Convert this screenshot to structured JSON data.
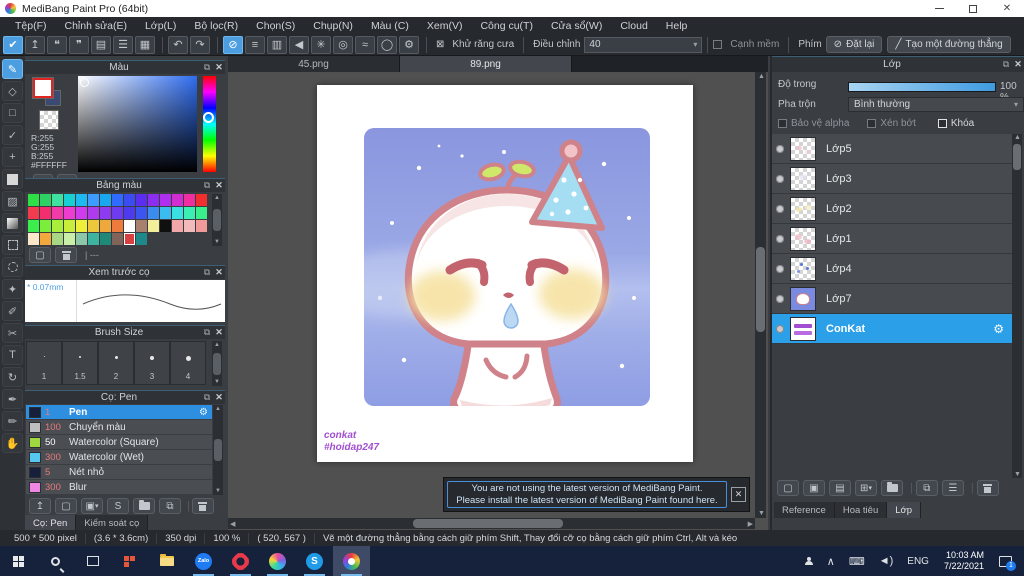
{
  "window": {
    "title": "MediBang Paint Pro (64bit)"
  },
  "menu": {
    "items": [
      "Tệp(F)",
      "Chỉnh sửa(E)",
      "Lớp(L)",
      "Bộ lọc(R)",
      "Chọn(S)",
      "Chụp(N)",
      "Màu (C)",
      "Xem(V)",
      "Công cụ(T)",
      "Cửa sổ(W)",
      "Cloud",
      "Help"
    ]
  },
  "icons": {
    "check": "✔",
    "share": "↥",
    "comment": "❝",
    "comment2": "❞",
    "doc": "▤",
    "doclist": "☰",
    "gridedit": "▦",
    "undo": "↶",
    "redo": "↷",
    "nosnap": "⊘",
    "parallel": "≡",
    "grid": "▥",
    "symmetry": "◀",
    "radial": "✳",
    "concentric": "◎",
    "curve": "≈",
    "ring": "◯",
    "gear": "⚙",
    "boxcheck": "⊠",
    "slash": "╱",
    "caret": "▾",
    "popout": "⧉",
    "close": "✕",
    "up": "▲",
    "down": "▼",
    "left": "◀",
    "right": "▶",
    "brush": "✎",
    "eraser": "◇",
    "rect": "□",
    "polyline": "✓",
    "move": "+",
    "wand": "✦",
    "selectpen": "✐",
    "selecteraser": "✂",
    "text": "T",
    "rotate": "↻",
    "pen2": "✒",
    "pencil": "✏",
    "hand": "✋",
    "new": "▢",
    "image": "▣",
    "sdoc": "S",
    "copy": "⧉",
    "addfolder": "⊞",
    "doc1": "▤",
    "upload": "↥"
  },
  "toolbar": {
    "antialias_label": "Khử răng cưa",
    "adjust_label": "Điều chỉnh",
    "adjust_value": "40",
    "soft_edge_label": "Cạnh mềm",
    "key_label": "Phím",
    "reset_label": "Đặt lại",
    "line_label": "Tạo một đường thẳng"
  },
  "color_panel": {
    "title": "Màu",
    "r": "R:255",
    "g": "G:255",
    "b": "B:255",
    "hex": "#FFFFFF"
  },
  "palette_panel": {
    "title": "Bảng màu",
    "empty_label": "| ---",
    "selected": {
      "row": 3,
      "index": 8
    },
    "rows": [
      [
        "#2ee045",
        "#2ed164",
        "#3fe0a0",
        "#18cfd4",
        "#1fb9f2",
        "#3e9bff",
        "#19a8f0",
        "#2f6bff",
        "#3b4df2",
        "#5a2ef0",
        "#8c2ef0",
        "#b02ef0",
        "#d02ed0",
        "#f02ea0",
        "#f22e2e"
      ],
      [
        "#f23b4e",
        "#f22e6e",
        "#f23ba8",
        "#ee3bd0",
        "#d03bee",
        "#b03bee",
        "#8c3bee",
        "#6e3bee",
        "#4e3bee",
        "#3b55ee",
        "#3b8cee",
        "#3bbcee",
        "#3be0e0",
        "#3beeb4",
        "#3bee8c"
      ],
      [
        "#3bee4e",
        "#7bee3b",
        "#a8ee3b",
        "#c8ee3b",
        "#eeee3b",
        "#eec83b",
        "#eea83b",
        "#ee7b3b",
        "#fcfcfc",
        "#a8806e",
        "#f2ee9a",
        "#101010",
        "#f2a8a8",
        "#f2baba",
        "#f29a9a"
      ],
      [
        "#fce8c8",
        "#f2a83b",
        "#a8d883",
        "#c8eea8",
        "#8cc8a8",
        "#3bb4a0",
        "#1f8878",
        "#80645a",
        "#d84040",
        "#1f8888"
      ]
    ]
  },
  "preview_panel": {
    "title": "Xem trước cọ",
    "size_label": "0.07mm",
    "size_prefix": "*"
  },
  "brush_size_panel": {
    "title": "Brush Size",
    "sizes": [
      "1",
      "1.5",
      "2",
      "3",
      "4"
    ]
  },
  "brush_panel": {
    "title": "Cọ: Pen",
    "brushes": [
      {
        "size": "1",
        "name": "Pen",
        "color": "#16203a",
        "size_color": "#e87b7b",
        "selected": true
      },
      {
        "size": "100",
        "name": "Chuyển màu",
        "color": "#bfbfbf",
        "size_color": "#e87b7b"
      },
      {
        "size": "50",
        "name": "Watercolor (Square)",
        "color": "#9fd83f",
        "size_color": "#ffffff"
      },
      {
        "size": "300",
        "name": "Watercolor (Wet)",
        "color": "#55c8f0",
        "size_color": "#e87b7b"
      },
      {
        "size": "5",
        "name": "Nét nhỏ",
        "color": "#16203a",
        "size_color": "#e87b7b"
      },
      {
        "size": "300",
        "name": "Blur",
        "color": "#ef86e2",
        "size_color": "#e87b7b"
      }
    ],
    "tabs": [
      "Cọ: Pen",
      "Kiểm soát cọ"
    ]
  },
  "canvas": {
    "tabs": [
      {
        "label": "45.png",
        "active": false
      },
      {
        "label": "89.png",
        "active": true
      }
    ],
    "signature": "conkat",
    "hashtag": "#hoidap247",
    "art_colors": {
      "background": "#8e9ae0",
      "outline": "#cf8289",
      "body": "#ffffff",
      "hat": "#a5ddf2",
      "cheek": "#f6e2a2",
      "tear": "#bcd9f4",
      "sprout": "#cfe86a",
      "pom": "#f2c3c8"
    }
  },
  "notification": {
    "line1": "You are not using the latest version of MediBang Paint.",
    "line2": "Please install the latest version of MediBang Paint found here.",
    "close": "✕"
  },
  "layers_panel": {
    "title": "Lớp",
    "opacity_label": "Độ trong",
    "opacity_value": "100 %",
    "blend_label": "Pha trộn",
    "blend_value": "Bình thường",
    "checkbox_alpha": "Bảo vệ alpha",
    "checkbox_clip": "Xén bớt",
    "checkbox_lock": "Khóa",
    "layers": [
      {
        "name": "Lớp5"
      },
      {
        "name": "Lớp3"
      },
      {
        "name": "Lớp2"
      },
      {
        "name": "Lớp1"
      },
      {
        "name": "Lớp4"
      },
      {
        "name": "Lớp7"
      },
      {
        "name": "ConKat",
        "selected": true
      }
    ],
    "tabs": [
      "Reference",
      "Hoa tiêu",
      "Lớp"
    ]
  },
  "status_bar": {
    "size": "500 * 500 pixel",
    "dims": "(3.6 * 3.6cm)",
    "dpi": "350 dpi",
    "zoom": "100 %",
    "coords": "( 520, 567 )",
    "hint": "Vẽ một đường thẳng bằng cách giữ phím Shift, Thay đổi cỡ cọ bằng cách giữ phím Ctrl, Alt và kéo"
  },
  "taskbar": {
    "zalo": "Zalo",
    "skype": "S",
    "language": "ENG",
    "time": "10:03 AM",
    "date": "7/22/2021",
    "badge": "1",
    "chevron": "∧",
    "keyboard": "⌨",
    "speaker": "◄)"
  }
}
